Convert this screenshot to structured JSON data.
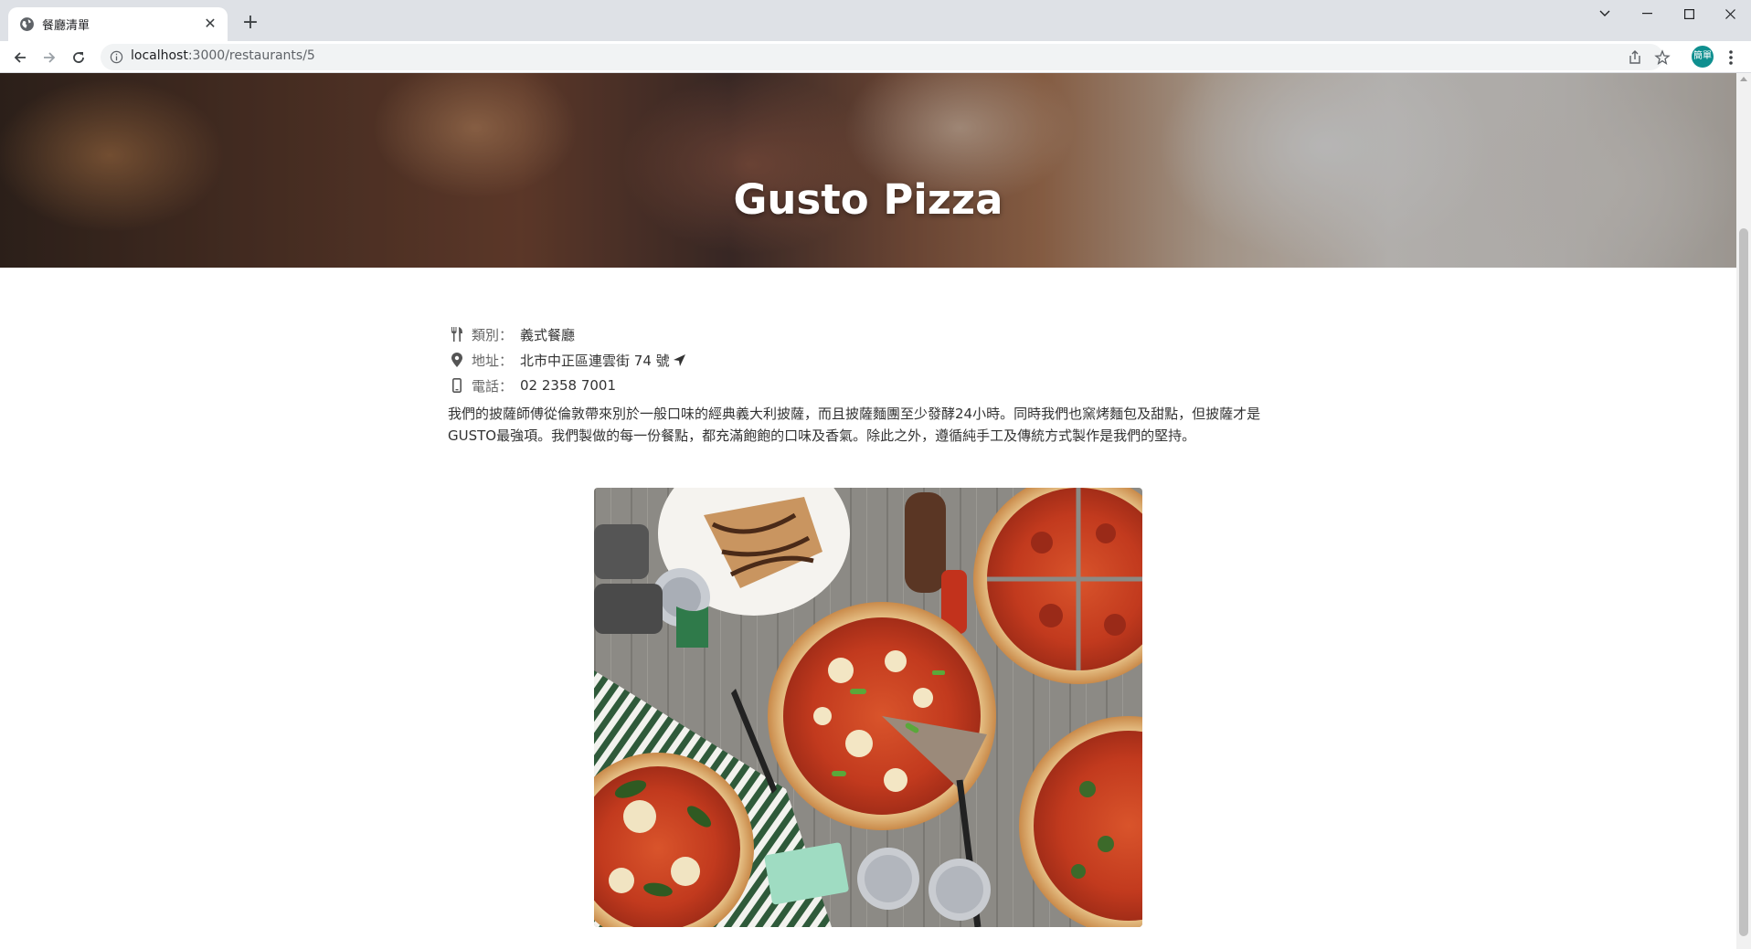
{
  "browser": {
    "tab_title": "餐廳清單",
    "url_host": "localhost",
    "url_path": ":3000/restaurants/5",
    "profile_label": "簡單"
  },
  "restaurant": {
    "name": "Gusto Pizza",
    "category_label": "類別：",
    "category": "義式餐廳",
    "address_label": "地址：",
    "address": "北市中正區連雲街 74 號",
    "phone_label": "電話：",
    "phone": "02 2358 7001",
    "description": "我們的披薩師傅從倫敦帶來別於一般口味的經典義大利披薩，而且披薩麵團至少發酵24小時。同時我們也窯烤麵包及甜點，但披薩才是GUSTO最強項。我們製做的每一份餐點，都充滿飽飽的口味及香氣。除此之外，遵循純手工及傳統方式製作是我們的堅持。"
  },
  "icons": {
    "favicon": "globe-icon",
    "category": "utensils-icon",
    "address": "map-marker-icon",
    "directions": "location-arrow-icon",
    "phone": "mobile-icon"
  }
}
